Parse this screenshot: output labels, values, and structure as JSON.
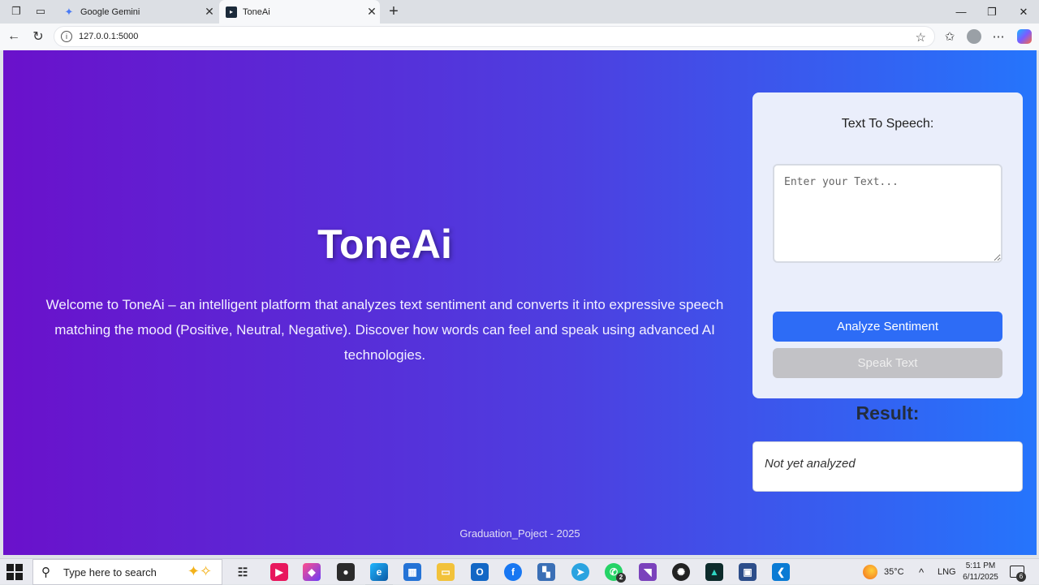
{
  "browser": {
    "tabs": [
      {
        "title": "Google Gemini",
        "active": false,
        "icon": "gemini-icon"
      },
      {
        "title": "ToneAi",
        "active": true,
        "icon": "toneai-favicon-icon"
      }
    ],
    "url": "127.0.0.1:5000"
  },
  "page": {
    "hero": {
      "title": "ToneAi",
      "description": "Welcome to ToneAi – an intelligent platform that analyzes text sentiment and converts it into expressive speech matching the mood (Positive, Neutral, Negative). Discover how words can feel and speak using advanced AI technologies."
    },
    "tts_panel": {
      "title": "Text To Speech:",
      "placeholder": "Enter your Text...",
      "analyze_label": "Analyze Sentiment",
      "speak_label": "Speak Text"
    },
    "result": {
      "title": "Result:",
      "value": "Not yet analyzed"
    },
    "footer": "Graduation_Poject - 2025",
    "colors": {
      "gradient_start": "#6a11cb",
      "gradient_end": "#2575fc",
      "analyze_button": "#2d6cf6",
      "speak_button_disabled": "#c2c2c6"
    }
  },
  "taskbar": {
    "search_placeholder": "Type here to search",
    "weather": "35°C",
    "language": "LNG",
    "time": "5:11 PM",
    "date": "6/11/2025",
    "whatsapp_badge": "2",
    "notification_count": "6"
  }
}
